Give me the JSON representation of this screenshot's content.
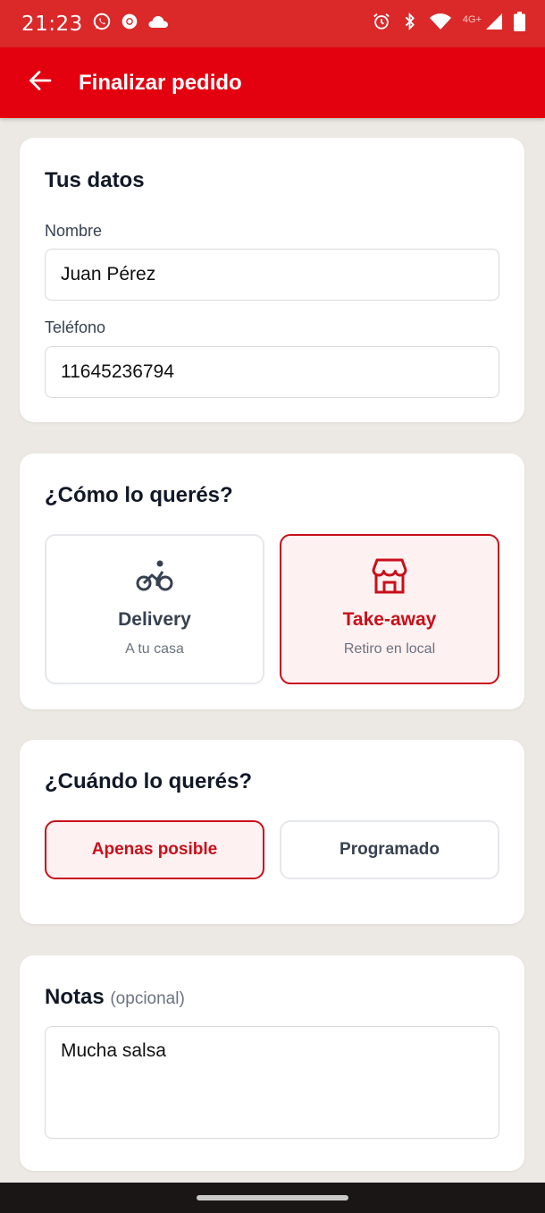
{
  "status_bar": {
    "time": "21:23",
    "network": "4G+",
    "icons_left": [
      "whatsapp-icon",
      "chrome-icon",
      "cloud-icon"
    ],
    "icons_right": [
      "alarm-icon",
      "bluetooth-icon",
      "wifi-icon",
      "signal-icon",
      "battery-icon"
    ]
  },
  "app_bar": {
    "title": "Finalizar pedido",
    "back_icon": "arrow-left-icon",
    "color": "#e3000f"
  },
  "datos": {
    "title": "Tus datos",
    "nombre_label": "Nombre",
    "nombre_value": "Juan Pérez",
    "telefono_label": "Teléfono",
    "telefono_value": "11645236794"
  },
  "como": {
    "title": "¿Cómo lo querés?",
    "options": [
      {
        "title": "Delivery",
        "subtitle": "A tu casa",
        "icon": "bicycle-icon",
        "selected": false
      },
      {
        "title": "Take-away",
        "subtitle": "Retiro en local",
        "icon": "store-icon",
        "selected": true
      }
    ]
  },
  "cuando": {
    "title": "¿Cuándo lo querés?",
    "options": [
      {
        "label": "Apenas posible",
        "selected": true
      },
      {
        "label": "Programado",
        "selected": false
      }
    ]
  },
  "notas": {
    "title": "Notas",
    "optional": "(opcional)",
    "value": "Mucha salsa"
  },
  "colors": {
    "accent": "#c8101a",
    "selected_bg": "#fef1f1",
    "page_bg": "#ece8e3"
  }
}
